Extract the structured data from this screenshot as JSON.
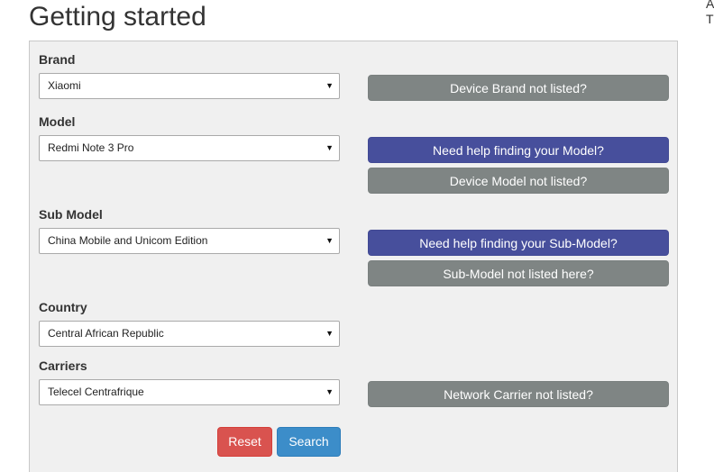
{
  "page": {
    "title": "Getting started",
    "side_clip": "A\nT"
  },
  "form": {
    "brand": {
      "label": "Brand",
      "value": "Xiaomi",
      "not_listed_button": "Device Brand not listed?"
    },
    "model": {
      "label": "Model",
      "value": "Redmi Note 3 Pro",
      "help_button": "Need help finding your Model?",
      "not_listed_button": "Device Model not listed?"
    },
    "sub_model": {
      "label": "Sub Model",
      "value": "China Mobile and Unicom Edition",
      "help_button": "Need help finding your Sub-Model?",
      "not_listed_button": "Sub-Model not listed here?"
    },
    "country": {
      "label": "Country",
      "value": "Central African Republic"
    },
    "carriers": {
      "label": "Carriers",
      "value": "Telecel Centrafrique",
      "not_listed_button": "Network Carrier not listed?"
    },
    "actions": {
      "reset_label": "Reset",
      "search_label": "Search"
    },
    "dropdown_caret": "▼"
  },
  "colors": {
    "gray_button": "#7f8584",
    "blue_button": "#474f9c",
    "reset_button": "#d9534f",
    "search_button": "#3c8dc9",
    "panel_background": "#f0f0f0"
  }
}
